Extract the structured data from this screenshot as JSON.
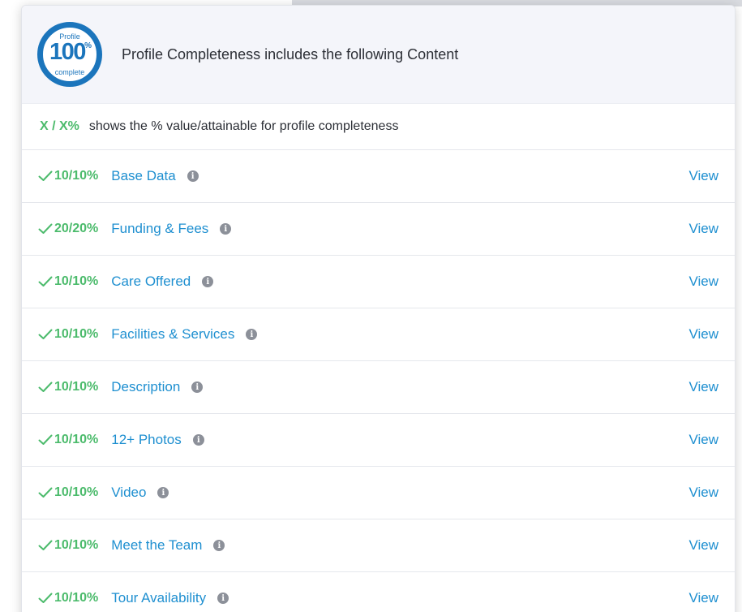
{
  "header": {
    "badge_top": "Profile",
    "badge_value": "100",
    "badge_unit": "%",
    "badge_bottom": "complete",
    "title": "Profile Completeness includes the following Content"
  },
  "legend": {
    "key": "X / X%",
    "text": "shows the % value/attainable for profile completeness"
  },
  "items": [
    {
      "score": "10/10%",
      "label": "Base Data",
      "action": "View"
    },
    {
      "score": "20/20%",
      "label": "Funding & Fees",
      "action": "View"
    },
    {
      "score": "10/10%",
      "label": "Care Offered",
      "action": "View"
    },
    {
      "score": "10/10%",
      "label": "Facilities & Services",
      "action": "View"
    },
    {
      "score": "10/10%",
      "label": "Description",
      "action": "View"
    },
    {
      "score": "10/10%",
      "label": "12+ Photos",
      "action": "View"
    },
    {
      "score": "10/10%",
      "label": "Video",
      "action": "View"
    },
    {
      "score": "10/10%",
      "label": "Meet the Team",
      "action": "View"
    },
    {
      "score": "10/10%",
      "label": "Tour Availability",
      "action": "View"
    }
  ],
  "colors": {
    "brand_blue": "#1b75bc",
    "link_blue": "#1e8fd0",
    "success_green": "#4cbb6c",
    "header_bg": "#f4f5fa"
  },
  "icons": {
    "check": "check-icon",
    "info": "info-icon"
  }
}
